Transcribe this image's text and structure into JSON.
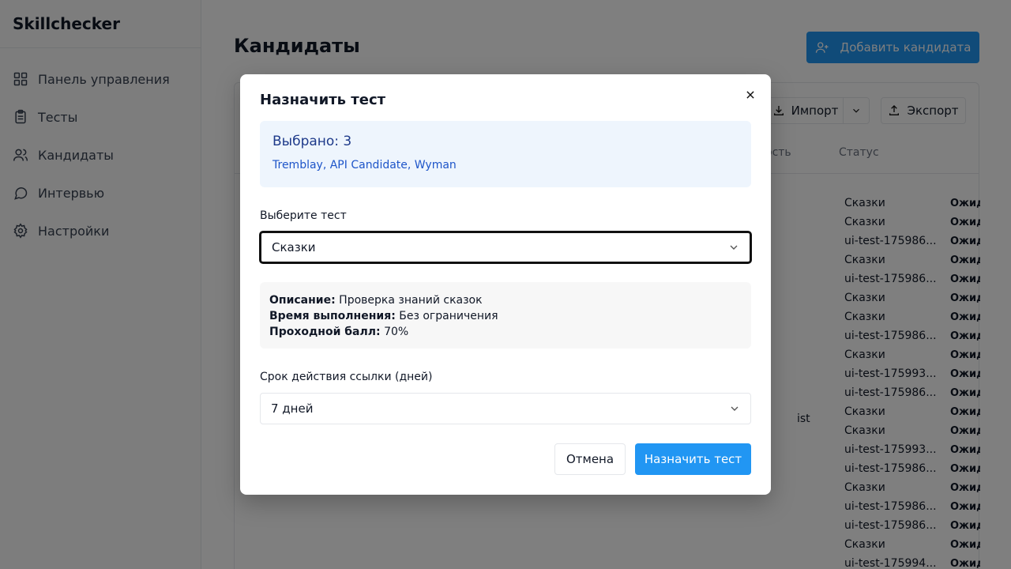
{
  "app": {
    "brand": "Skillchecker"
  },
  "sidebar": {
    "items": [
      {
        "label": "Панель управления",
        "icon": "grid-icon"
      },
      {
        "label": "Тесты",
        "icon": "clipboard-icon"
      },
      {
        "label": "Кандидаты",
        "icon": "users-icon"
      },
      {
        "label": "Интервью",
        "icon": "chat-icon"
      },
      {
        "label": "Настройки",
        "icon": "gear-icon"
      }
    ]
  },
  "page": {
    "title": "Кандидаты",
    "add_button": "Добавить кандидата",
    "import_button": "Импорт",
    "export_button": "Экспорт",
    "columns": {
      "col_partial": "ость",
      "status": "Статус"
    },
    "stray_text": "ist",
    "rows": [
      {
        "test": "Сказки",
        "status": "Ожид"
      },
      {
        "test": "Сказки",
        "status": "Ожид"
      },
      {
        "test": "ui-test-175986...",
        "status": "Ожид"
      },
      {
        "test": "Сказки",
        "status": "Ожид"
      },
      {
        "test": "ui-test-175986...",
        "status": "Ожид"
      },
      {
        "test": "Сказки",
        "status": "Ожид"
      },
      {
        "test": "Сказки",
        "status": "Ожид"
      },
      {
        "test": "ui-test-175986...",
        "status": "Ожид"
      },
      {
        "test": "Сказки",
        "status": "Ожид"
      },
      {
        "test": "ui-test-175993...",
        "status": "Ожид"
      },
      {
        "test": "ui-test-175986...",
        "status": "Ожид"
      },
      {
        "test": "Сказки",
        "status": "Ожид"
      },
      {
        "test": "Сказки",
        "status": "Ожид"
      },
      {
        "test": "ui-test-175993...",
        "status": "Ожид"
      },
      {
        "test": "ui-test-175986...",
        "status": "Ожид"
      },
      {
        "test": "Сказки",
        "status": "Ожид"
      },
      {
        "test": "ui-test-175986...",
        "status": "Ожид"
      },
      {
        "test": "ui-test-175986...",
        "status": "Ожид"
      },
      {
        "test": "Сказки",
        "status": "Ожид"
      },
      {
        "test": "ui-test-175994...",
        "status": "Ожид"
      }
    ]
  },
  "modal": {
    "title": "Назначить тест",
    "selected_count": "Выбрано: 3",
    "selected_names": "Tremblay, API Candidate, Wyman",
    "test_label": "Выберите тест",
    "test_value": "Сказки",
    "info": {
      "description_label": "Описание:",
      "description_value": "Проверка знаний сказок",
      "time_label": "Время выполнения:",
      "time_value": "Без ограничения",
      "pass_label": "Проходной балл:",
      "pass_value": "70%"
    },
    "link_label": "Срок действия ссылки (дней)",
    "link_value": "7 дней",
    "cancel": "Отмена",
    "submit": "Назначить тест"
  },
  "colors": {
    "accent": "#2196f3",
    "selected_bg": "#eef5fd",
    "overlay": "rgba(0,0,0,0.5)"
  }
}
